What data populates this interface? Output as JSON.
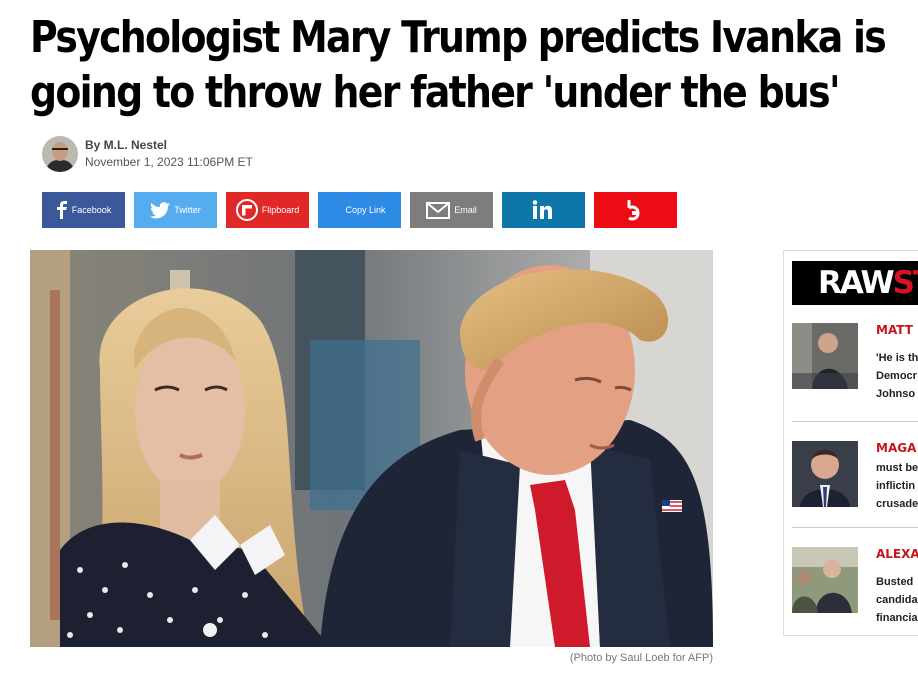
{
  "article": {
    "headline_line1": "Psychologist Mary Trump predicts Ivanka is",
    "headline_line2": "going to throw her father 'under the bus'",
    "author": "By M.L. Nestel",
    "date": "November 1, 2023 11:06PM ET",
    "photo_caption": "(Photo by Saul Loeb for AFP)"
  },
  "share": [
    {
      "label": "Facebook",
      "icon": "facebook-icon",
      "color": "#3b5998"
    },
    {
      "label": "Twitter",
      "icon": "twitter-icon",
      "color": "#55acee"
    },
    {
      "label": "Flipboard",
      "icon": "flipboard-icon",
      "color": "#e12828"
    },
    {
      "label": "Copy Link",
      "icon": "copy-link-icon",
      "color": "#2d8ae5"
    },
    {
      "label": "Email",
      "icon": "email-icon",
      "color": "#7d7d7d"
    },
    {
      "label": "",
      "icon": "linkedin-icon",
      "color": "#0e76a8"
    },
    {
      "label": "",
      "icon": "substack-icon",
      "color": "#ee0c14"
    }
  ],
  "sidebar": {
    "logo_white": "RAW",
    "logo_red": "ST",
    "items": [
      {
        "kicker": "MATT LA",
        "lines": [
          "'He is th",
          "Democr",
          "Johnso"
        ]
      },
      {
        "kicker": "MAGA I",
        "lines": [
          "must be",
          "inflictin",
          "crusade"
        ]
      },
      {
        "kicker": "ALEXAN",
        "lines": [
          "Busted",
          "candida",
          "financia"
        ]
      }
    ]
  },
  "colors": {
    "accent_red": "#c4161c",
    "headline": "#000000"
  }
}
